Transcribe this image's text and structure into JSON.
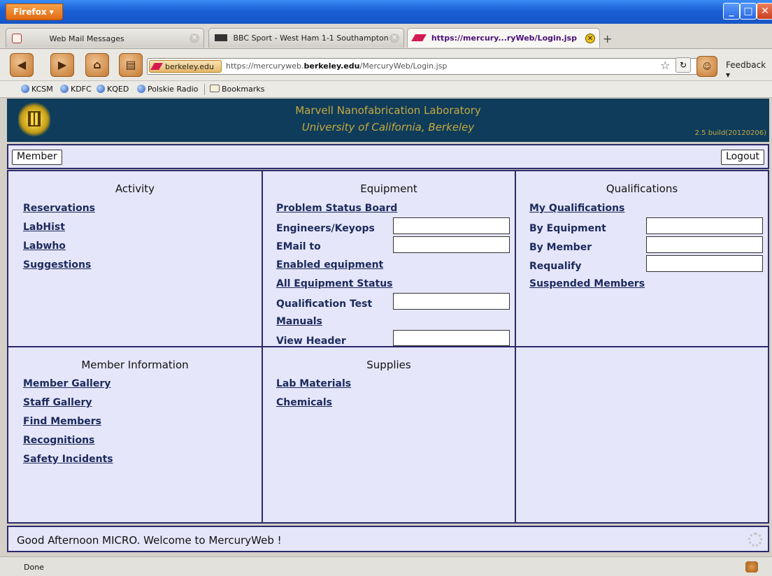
{
  "browser": {
    "menu_button": "Firefox ▾",
    "tabs": [
      {
        "label": "Web Mail Messages"
      },
      {
        "label": "BBC Sport - West Ham 1-1 Southampton"
      },
      {
        "label": "https://mercury...ryWeb/Login.jsp"
      }
    ],
    "new_tab": "+",
    "site_badge": "berkeley.edu",
    "url_prefix": "https://mercuryweb.",
    "url_domain": "berkeley.edu",
    "url_path": "/MercuryWeb/Login.jsp",
    "feedback": "Feedback ▾",
    "bookmarks": [
      "KCSM",
      "KDFC",
      "KQED",
      "Polskie Radio",
      "Bookmarks"
    ],
    "status": "Done",
    "accent_color": "#1a5fd6"
  },
  "header": {
    "lab_name": "Marvell Nanofabrication Laboratory",
    "university": "University of California, Berkeley",
    "build": "2.5 build(20120206)"
  },
  "toolbar": {
    "member_label": "Member",
    "logout_label": "Logout"
  },
  "activity": {
    "title": "Activity",
    "links": [
      "Reservations",
      "LabHist",
      "Labwho",
      "Suggestions"
    ]
  },
  "equipment": {
    "title": "Equipment",
    "problem_board": "Problem Status Board",
    "engineers_label": "Engineers/Keyops",
    "email_label": "EMail to",
    "enabled": "Enabled equipment",
    "all_status": "All Equipment Status",
    "qual_test_label": "Qualification Test",
    "manuals": "Manuals",
    "view_header_label": "View Header"
  },
  "qualifications": {
    "title": "Qualifications",
    "my_quals": "My Qualifications",
    "by_equipment": "By Equipment",
    "by_member": "By Member",
    "requalify": "Requalify",
    "suspended": "Suspended Members"
  },
  "member_info": {
    "title": "Member Information",
    "links": [
      "Member Gallery",
      "Staff Gallery",
      "Find Members",
      "Recognitions",
      "Safety Incidents"
    ]
  },
  "supplies": {
    "title": "Supplies",
    "links": [
      "Lab Materials",
      "Chemicals"
    ]
  },
  "welcome": "Good Afternoon MICRO. Welcome to MercuryWeb !"
}
